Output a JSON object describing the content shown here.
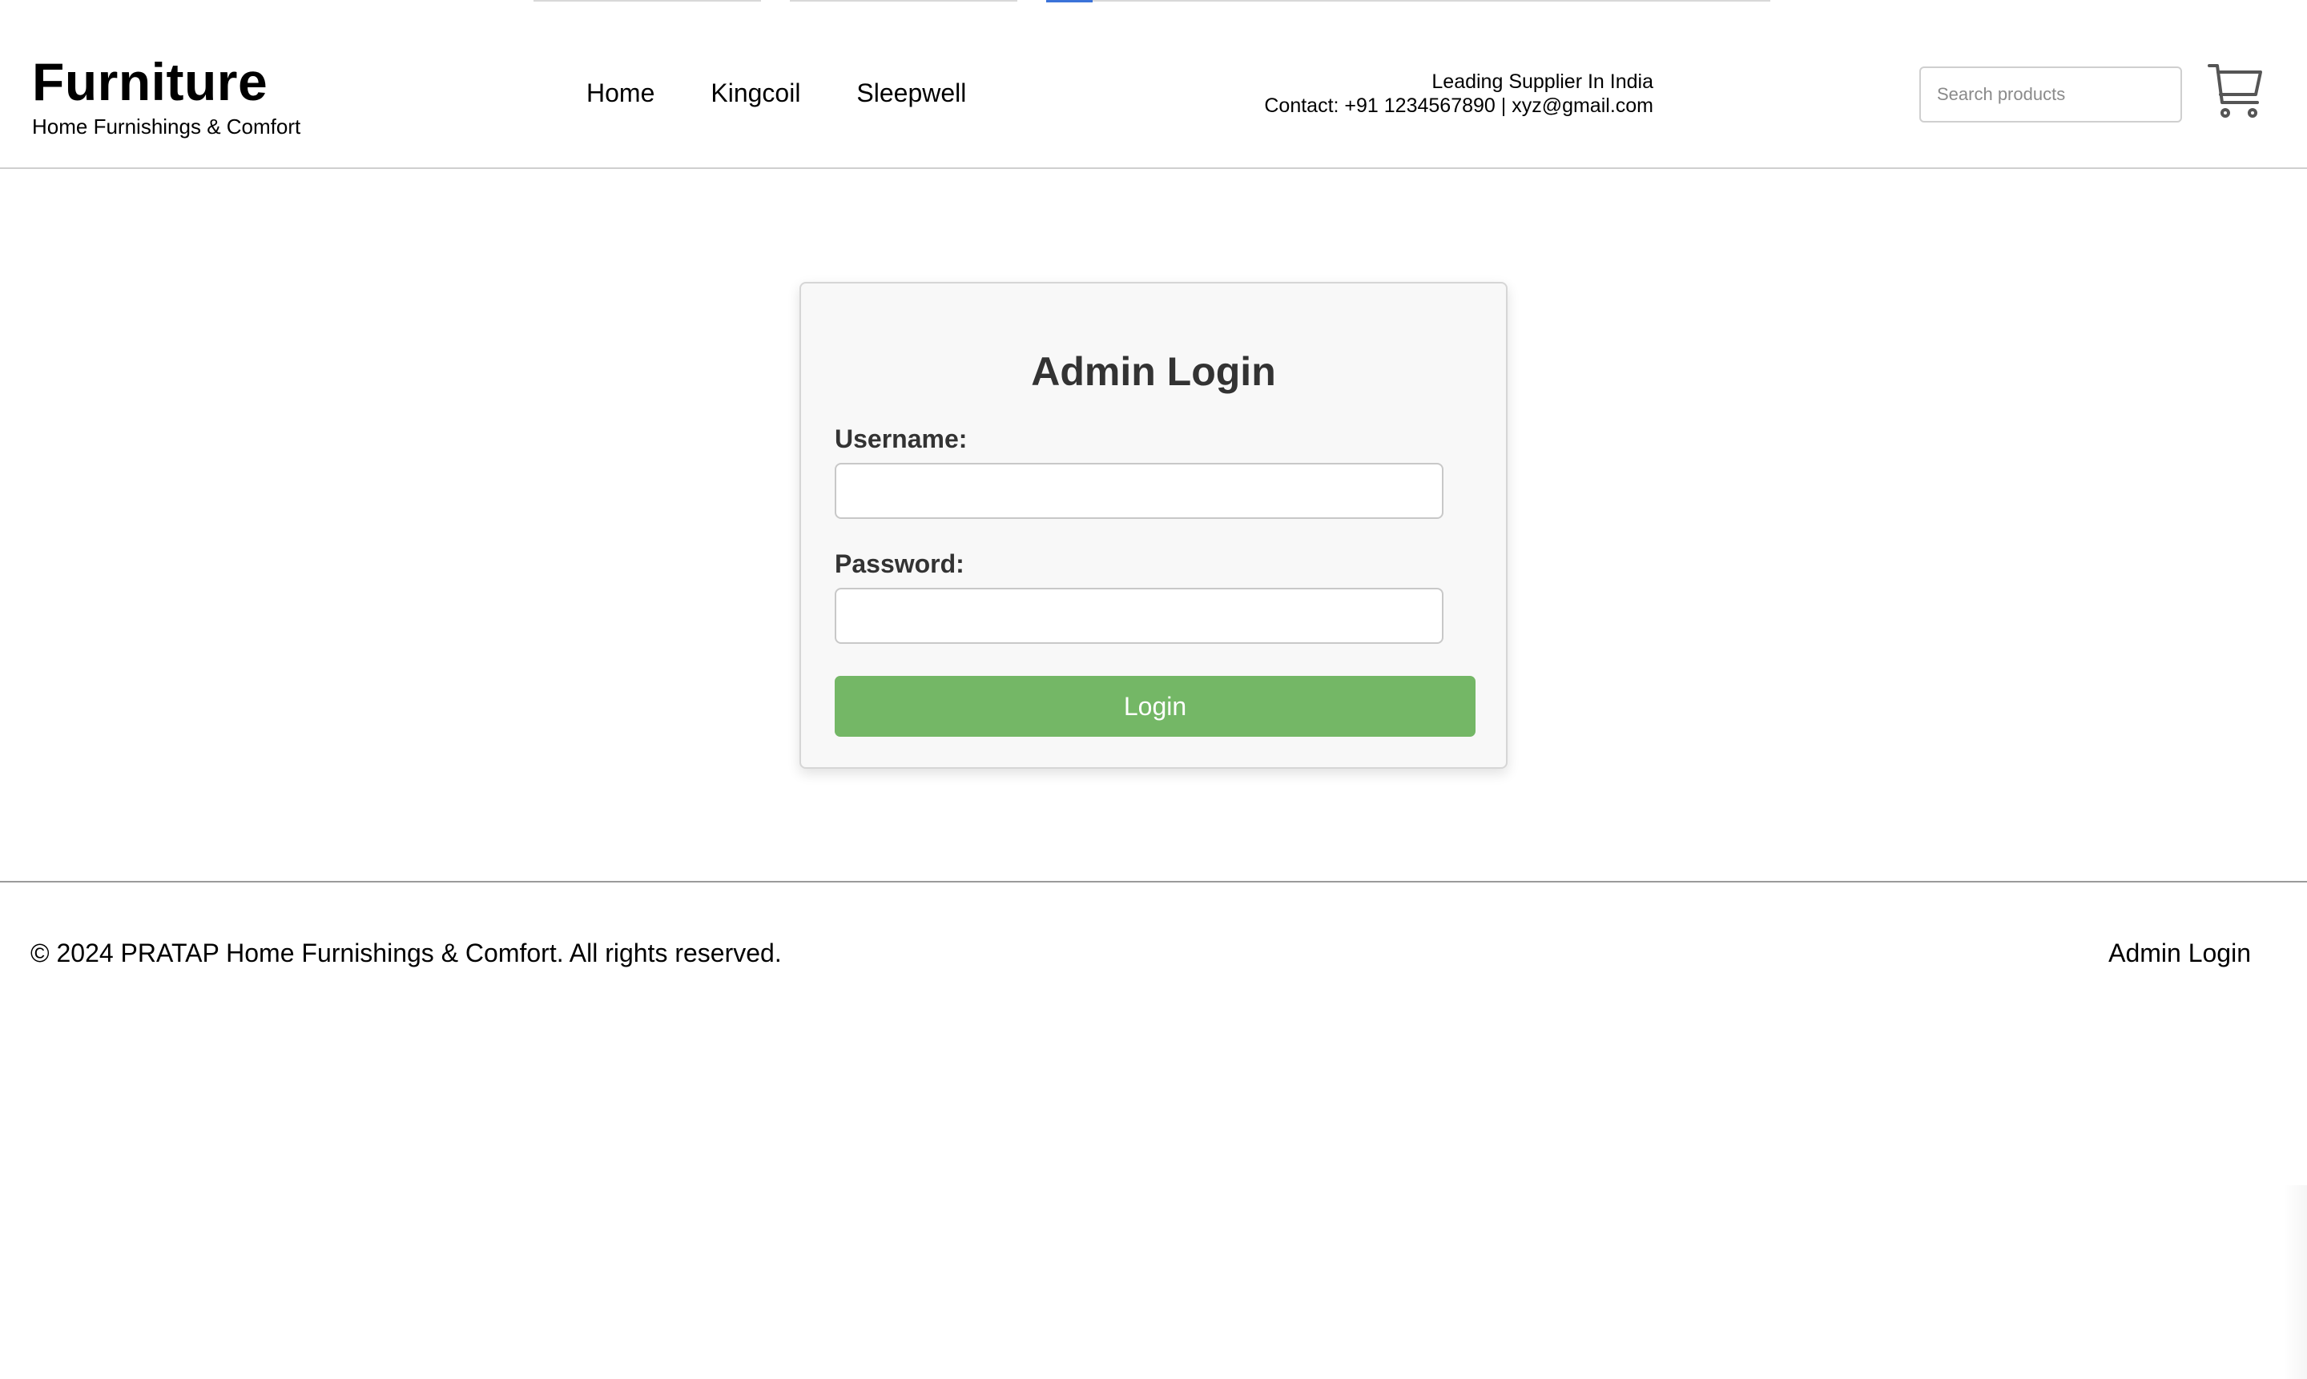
{
  "header": {
    "brand_title": "Furniture",
    "brand_tagline": "Home Furnishings & Comfort",
    "nav": [
      {
        "label": "Home"
      },
      {
        "label": "Kingcoil"
      },
      {
        "label": "Sleepwell"
      }
    ],
    "contact_line1": "Leading Supplier In India",
    "contact_line2": "Contact: +91 1234567890 | xyz@gmail.com",
    "search_placeholder": "Search products",
    "search_value": "",
    "cart_icon": "shopping-cart-icon"
  },
  "login": {
    "title": "Admin Login",
    "username_label": "Username:",
    "username_value": "",
    "password_label": "Password:",
    "password_value": "",
    "submit_label": "Login",
    "button_color": "#74b766"
  },
  "footer": {
    "copyright": "© 2024 PRATAP Home Furnishings & Comfort. All rights reserved.",
    "admin_link": "Admin Login"
  }
}
